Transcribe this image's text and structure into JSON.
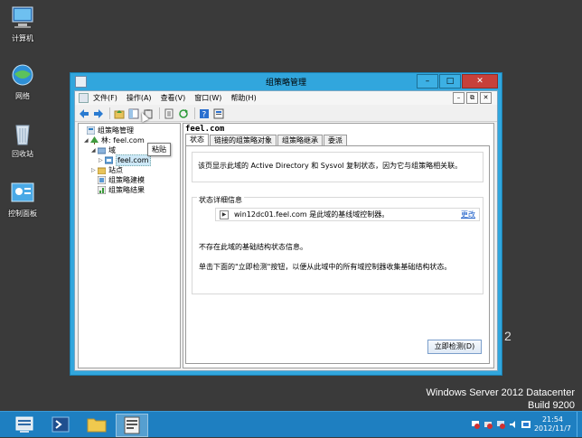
{
  "desktop": {
    "icons": [
      {
        "label": "计算机",
        "icon": "computer-icon"
      },
      {
        "label": "网络",
        "icon": "network-icon"
      },
      {
        "label": "回收站",
        "icon": "recycle-bin-icon"
      },
      {
        "label": "控制面板",
        "icon": "control-panel-icon"
      }
    ],
    "watermark": {
      "line1": "Windows Server 2012 Datacenter",
      "line2": "Build 9200"
    },
    "partial_char": "2"
  },
  "window": {
    "title": "组策略管理",
    "menu": [
      "文件(F)",
      "操作(A)",
      "查看(V)",
      "窗口(W)",
      "帮助(H)"
    ],
    "tooltip": "粘贴",
    "tree": {
      "root": "组策略管理",
      "forest": "林: feel.com",
      "domains": "域",
      "domain": "feel.com",
      "sites": "站点",
      "modeling": "组策略建模",
      "results": "组策略结果"
    },
    "pane": {
      "header": "feel.com",
      "tabs": [
        "状态",
        "链接的组策略对象",
        "组策略继承",
        "委派"
      ],
      "description": "该页显示此域的 Active Directory 和 Sysvol 复制状态，因为它与组策略相关联。",
      "detail_title": "状态详细信息",
      "dc_row": "win12dc01.feel.com 是此域的基线域控制器。",
      "more_link": "更改",
      "info1": "不存在此域的基础结构状态信息。",
      "info2": "单击下面的\"立即检测\"按钮，以便从此域中的所有域控制器收集基础结构状态。",
      "detect_button": "立即检测(D)"
    }
  },
  "taskbar": {
    "clock_time": "21:54",
    "clock_date": "2012/11/7"
  },
  "colors": {
    "window_accent": "#31a6dd",
    "taskbar": "#1e7fc1",
    "desktop_bg": "#3a3a3a",
    "close_red": "#c7403a",
    "link": "#1a5dc8"
  }
}
